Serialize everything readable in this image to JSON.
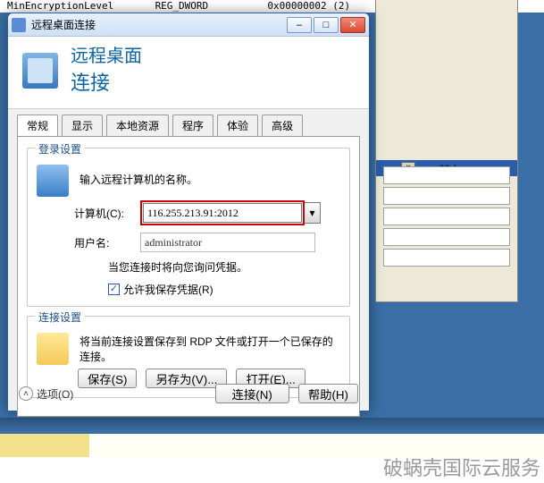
{
  "regrow": "MinEncryptionLevel       REG_DWORD          0x00000002 (2)",
  "dialog": {
    "title": "远程桌面连接",
    "banner_line1": "远程桌面",
    "banner_line2": "连接"
  },
  "tabs": [
    "常规",
    "显示",
    "本地资源",
    "程序",
    "体验",
    "高级"
  ],
  "login": {
    "legend": "登录设置",
    "intro": "输入远程计算机的名称。",
    "computer_label": "计算机(C):",
    "computer_value": "116.255.213.91:2012",
    "user_label": "用户名:",
    "user_value": "administrator",
    "note": "当您连接时将向您询问凭据。",
    "save_creds": "允许我保存凭据(R)"
  },
  "conn": {
    "legend": "连接设置",
    "intro": "将当前连接设置保存到 RDP 文件或打开一个已保存的连接。",
    "save": "保存(S)",
    "save_as": "另存为(V)...",
    "open": "打开(E)..."
  },
  "footer": {
    "options": "选项(O)",
    "connect": "连接(N)",
    "help": "帮助(H)"
  },
  "bg_label": "c 00 (",
  "watermark": "破蜗壳国际云服务"
}
